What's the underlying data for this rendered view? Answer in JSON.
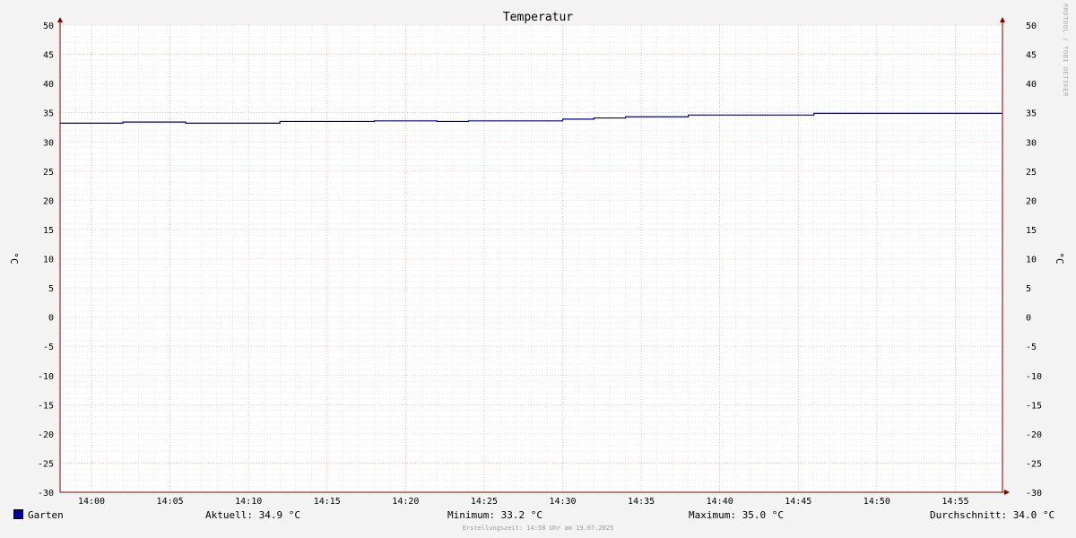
{
  "chart_data": {
    "type": "line",
    "title": "Temperatur",
    "ylabel": "°C",
    "ylabel_right": "°C",
    "ylim": [
      -30,
      50
    ],
    "y_ticks": [
      50,
      45,
      40,
      35,
      30,
      25,
      20,
      15,
      10,
      5,
      0,
      -5,
      -10,
      -15,
      -20,
      -25,
      -30
    ],
    "x_range": [
      "13:58",
      "14:58"
    ],
    "x_ticks": [
      "14:00",
      "14:05",
      "14:10",
      "14:15",
      "14:20",
      "14:25",
      "14:30",
      "14:35",
      "14:40",
      "14:45",
      "14:50",
      "14:55"
    ],
    "grid": true,
    "series": [
      {
        "name": "Garten",
        "color": "#000080",
        "points": [
          [
            "13:58",
            33.2
          ],
          [
            "14:02",
            33.4
          ],
          [
            "14:06",
            33.2
          ],
          [
            "14:12",
            33.5
          ],
          [
            "14:18",
            33.6
          ],
          [
            "14:22",
            33.5
          ],
          [
            "14:24",
            33.6
          ],
          [
            "14:30",
            33.9
          ],
          [
            "14:32",
            34.1
          ],
          [
            "14:34",
            34.3
          ],
          [
            "14:38",
            34.6
          ],
          [
            "14:46",
            34.9
          ],
          [
            "14:58",
            34.9
          ]
        ]
      }
    ]
  },
  "legend": {
    "series_name": "Garten",
    "series_color": "#00009c",
    "current": "Aktuell: 34.9 °C",
    "minimum": "Minimum: 33.2 °C",
    "maximum": "Maximum: 35.0 °C",
    "average": "Durchschnitt: 34.0 °C"
  },
  "footer": "Erstellungszeit: 14:58 Uhr am 19.07.2025",
  "watermark": "RRDTOOL / TOBI OETIKER",
  "colors": {
    "background": "#f3f3f3",
    "plot_background": "#ffffff",
    "minor_grid": "#d0d0d0",
    "major_grid": "#e8a0a0",
    "axis": "#7f0000"
  }
}
